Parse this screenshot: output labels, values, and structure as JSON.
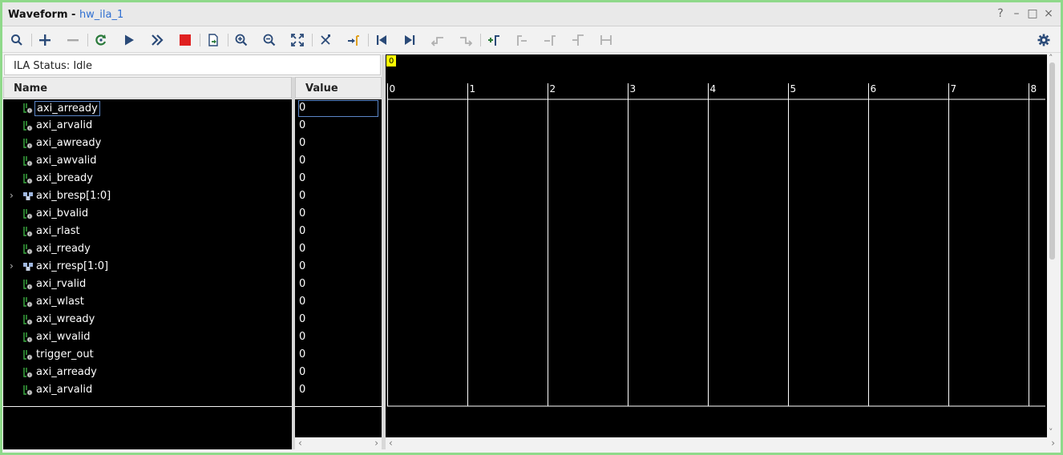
{
  "window": {
    "title": "Waveform - ",
    "subtitle": "hw_ila_1",
    "controls": [
      "?",
      "–",
      "□",
      "×"
    ]
  },
  "toolbar": {
    "buttons": [
      "search-icon",
      "add-icon",
      "remove-icon",
      "refresh-icon",
      "run-trigger-icon",
      "run-immediate-icon",
      "stop-icon",
      "export-icon",
      "zoom-in-icon",
      "zoom-out-icon",
      "zoom-fit-icon",
      "cursor-icon",
      "go-to-cursor-icon",
      "go-to-start-icon",
      "go-to-end-icon",
      "previous-transition-icon",
      "next-transition-icon",
      "add-marker-icon",
      "previous-marker-icon",
      "next-marker-icon",
      "swap-cursors-icon",
      "distance-icon",
      "settings-icon"
    ]
  },
  "status": {
    "text": "ILA Status: Idle"
  },
  "columns": {
    "name": "Name",
    "value": "Value"
  },
  "signals": [
    {
      "name": "axi_arready",
      "value": "0",
      "type": "bit",
      "expandable": false
    },
    {
      "name": "axi_arvalid",
      "value": "0",
      "type": "bit",
      "expandable": false
    },
    {
      "name": "axi_awready",
      "value": "0",
      "type": "bit",
      "expandable": false
    },
    {
      "name": "axi_awvalid",
      "value": "0",
      "type": "bit",
      "expandable": false
    },
    {
      "name": "axi_bready",
      "value": "0",
      "type": "bit",
      "expandable": false
    },
    {
      "name": "axi_bresp[1:0]",
      "value": "0",
      "type": "bus",
      "expandable": true
    },
    {
      "name": "axi_bvalid",
      "value": "0",
      "type": "bit",
      "expandable": false
    },
    {
      "name": "axi_rlast",
      "value": "0",
      "type": "bit",
      "expandable": false
    },
    {
      "name": "axi_rready",
      "value": "0",
      "type": "bit",
      "expandable": false
    },
    {
      "name": "axi_rresp[1:0]",
      "value": "0",
      "type": "bus",
      "expandable": true
    },
    {
      "name": "axi_rvalid",
      "value": "0",
      "type": "bit",
      "expandable": false
    },
    {
      "name": "axi_wlast",
      "value": "0",
      "type": "bit",
      "expandable": false
    },
    {
      "name": "axi_wready",
      "value": "0",
      "type": "bit",
      "expandable": false
    },
    {
      "name": "axi_wvalid",
      "value": "0",
      "type": "bit",
      "expandable": false
    },
    {
      "name": "trigger_out",
      "value": "0",
      "type": "bit",
      "expandable": false
    },
    {
      "name": "axi_arready",
      "value": "0",
      "type": "bit",
      "expandable": false
    },
    {
      "name": "axi_arvalid",
      "value": "0",
      "type": "bit",
      "expandable": false
    }
  ],
  "selected_index": 0,
  "waveform": {
    "marker_label": "0",
    "time_ticks": [
      "0",
      "1",
      "2",
      "3",
      "4",
      "5",
      "6",
      "7",
      "8"
    ],
    "colors": {
      "background": "#000000",
      "grid": "#ffffff",
      "marker": "#ffff00"
    }
  }
}
